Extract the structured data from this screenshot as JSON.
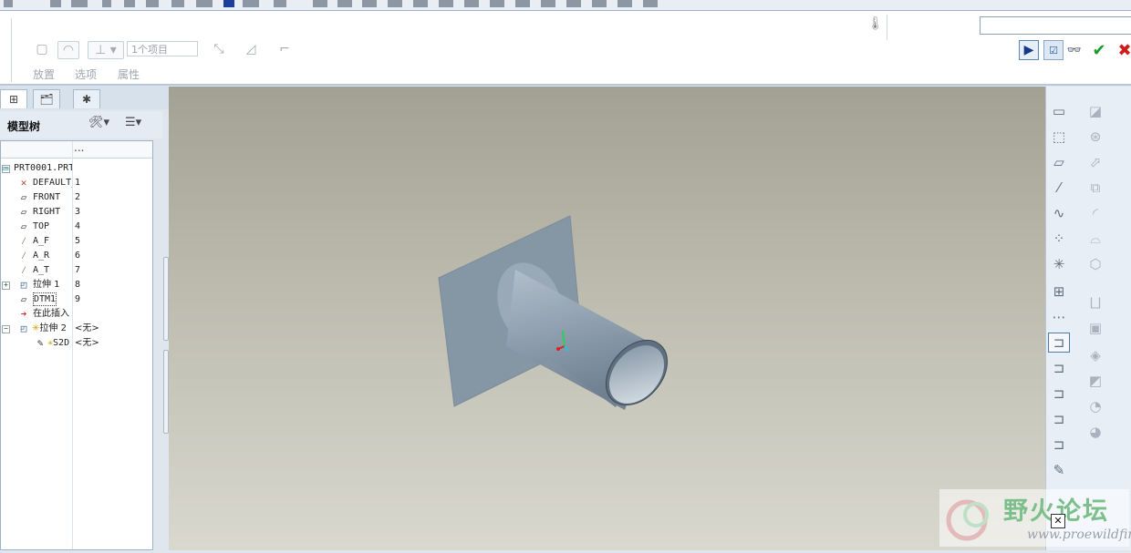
{
  "dashboard": {
    "item_collector": "1个项目",
    "tabs": [
      "放置",
      "选项",
      "属性"
    ]
  },
  "navigator": {
    "title": "模型树",
    "column_header": "...",
    "tree": [
      {
        "label": "PRT0001.PRT",
        "value": "",
        "icon": "part-icon"
      },
      {
        "label": "DEFAULT_",
        "value": "1",
        "icon": "csys-icon"
      },
      {
        "label": "FRONT",
        "value": "2",
        "icon": "datum-plane-icon"
      },
      {
        "label": "RIGHT",
        "value": "3",
        "icon": "datum-plane-icon"
      },
      {
        "label": "TOP",
        "value": "4",
        "icon": "datum-plane-icon"
      },
      {
        "label": "A_F",
        "value": "5",
        "icon": "datum-axis-icon"
      },
      {
        "label": "A_R",
        "value": "6",
        "icon": "datum-axis-icon"
      },
      {
        "label": "A_T",
        "value": "7",
        "icon": "datum-axis-icon"
      },
      {
        "label": "拉伸 1",
        "value": "8",
        "icon": "extrude-icon"
      },
      {
        "label": "DTM1",
        "value": "9",
        "icon": "datum-plane-icon"
      },
      {
        "label": "在此插入",
        "value": "",
        "icon": "insert-arrow-icon"
      },
      {
        "label": "拉伸 2",
        "value": "<无>",
        "icon": "extrude-icon"
      },
      {
        "label": "S2D",
        "value": "<无>",
        "icon": "sketch-icon"
      }
    ]
  },
  "watermark": {
    "title": "野火论坛",
    "url": "www.proewildfire.cn"
  },
  "colors": {
    "viewport_top": "#a3a194",
    "viewport_bottom": "#d9d8cf",
    "ok_green": "#1c9a2a",
    "cancel_red": "#d21a1a"
  }
}
